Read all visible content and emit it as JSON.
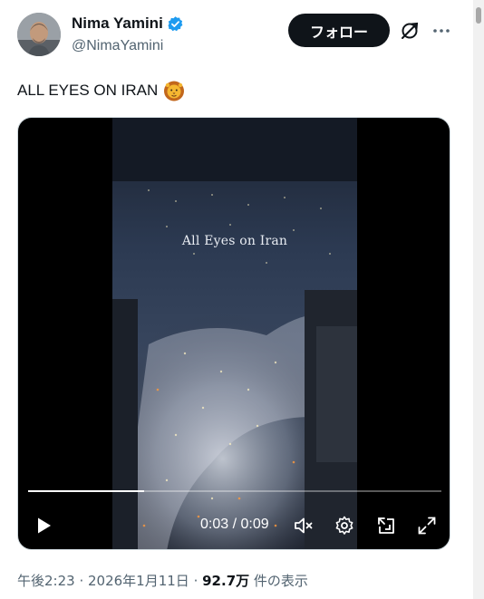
{
  "author": {
    "display_name": "Nima Yamini",
    "handle": "@NimaYamini",
    "verified_icon": "verified-badge-icon",
    "verified_color": "#1d9bf0"
  },
  "header": {
    "follow_label": "フォロー",
    "grok_icon": "grok-icon",
    "more_icon": "more-options-icon"
  },
  "tweet": {
    "text": "ALL EYES ON IRAN",
    "emoji": "lion-face-icon"
  },
  "video": {
    "overlay_caption": "All Eyes on Iran",
    "current_time": "0:03",
    "duration": "0:09",
    "time_display": "0:03 / 0:09",
    "progress_fraction": 0.28,
    "controls": {
      "play_icon": "play-icon",
      "mute_icon": "muted-speaker-icon",
      "settings_icon": "settings-gear-icon",
      "dock_icon": "dock-minimize-icon",
      "expand_icon": "fullscreen-expand-icon"
    }
  },
  "meta": {
    "time": "午後2:23",
    "separator": " · ",
    "date": "2026年1月11日",
    "views_count": "92.7万",
    "views_label": " 件の表示"
  },
  "colors": {
    "text_primary": "#0f1419",
    "text_secondary": "#536471",
    "follow_bg": "#0f1419",
    "video_bg": "#000000"
  }
}
